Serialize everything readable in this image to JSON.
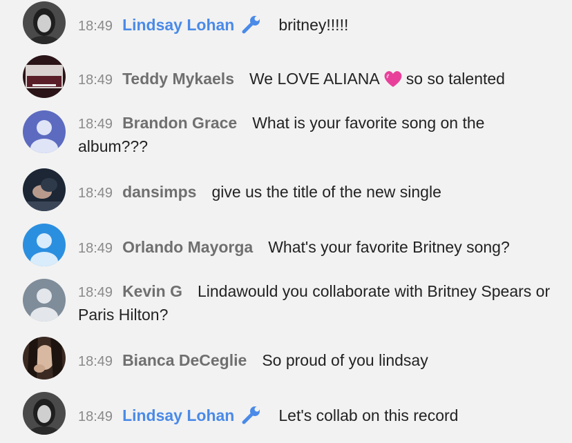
{
  "colors": {
    "background": "#f2f2f2",
    "owner_name": "#4a8ae8",
    "author_name": "#6f6f6f",
    "timestamp": "#8a8a8a",
    "message_text": "#222222",
    "default_avatar_purple": "#5c6bc0",
    "default_avatar_blue": "#2b8fe0",
    "default_avatar_gray": "#7f8c99",
    "heart": "#e8409a"
  },
  "messages": [
    {
      "time": "18:49",
      "author": "Lindsay Lohan",
      "owner": true,
      "badge": "wrench-icon",
      "text": "britney!!!!!",
      "avatar": "photo"
    },
    {
      "time": "18:49",
      "author": "Teddy Mykaels",
      "owner": false,
      "text_before": "We LOVE ALIANA",
      "emoji": "pink-heart-icon",
      "text_after": "so so talented",
      "avatar": "album-cover"
    },
    {
      "time": "18:49",
      "author": "Brandon Grace",
      "owner": false,
      "text": "What is your favorite song on the album???",
      "avatar": "default-purple"
    },
    {
      "time": "18:49",
      "author": "dansimps",
      "owner": false,
      "text": "give us the title of the new single",
      "avatar": "photo"
    },
    {
      "time": "18:49",
      "author": "Orlando Mayorga",
      "owner": false,
      "text": "What's your favorite Britney song?",
      "avatar": "default-blue"
    },
    {
      "time": "18:49",
      "author": "Kevin G",
      "owner": false,
      "text": "Lindawould you collaborate with Britney Spears or Paris Hilton?",
      "avatar": "default-gray"
    },
    {
      "time": "18:49",
      "author": "Bianca DeCeglie",
      "owner": false,
      "text": "So proud of you lindsay",
      "avatar": "photo"
    },
    {
      "time": "18:49",
      "author": "Lindsay Lohan",
      "owner": true,
      "badge": "wrench-icon",
      "text": "Let's collab on this record",
      "avatar": "photo"
    }
  ]
}
